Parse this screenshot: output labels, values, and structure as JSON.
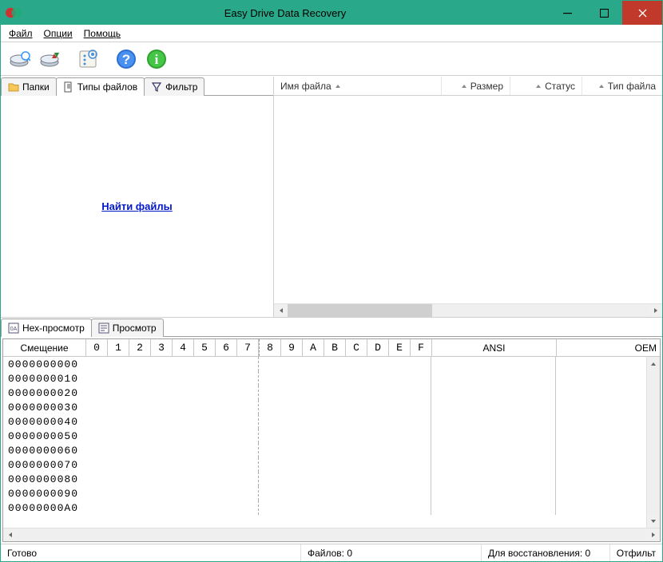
{
  "title": "Easy Drive Data Recovery",
  "menu": {
    "file": "Файл",
    "options": "Опции",
    "help": "Помощь"
  },
  "left_tabs": {
    "folders": "Папки",
    "file_types": "Типы файлов",
    "filter": "Фильтр"
  },
  "find_link": "Найти файлы",
  "list_columns": {
    "name": "Имя файла",
    "size": "Размер",
    "status": "Статус",
    "type": "Тип файла"
  },
  "lower_tabs": {
    "hex": "Нех-просмотр",
    "preview": "Просмотр"
  },
  "hex_header": {
    "offset": "Смещение",
    "bytes": [
      "0",
      "1",
      "2",
      "3",
      "4",
      "5",
      "6",
      "7",
      "8",
      "9",
      "A",
      "B",
      "C",
      "D",
      "E",
      "F"
    ],
    "ansi": "ANSI",
    "oem": "OEM"
  },
  "offsets": [
    "0000000000",
    "0000000010",
    "0000000020",
    "0000000030",
    "0000000040",
    "0000000050",
    "0000000060",
    "0000000070",
    "0000000080",
    "0000000090",
    "00000000A0"
  ],
  "status": {
    "ready": "Готово",
    "files": "Файлов: 0",
    "restore": "Для восстановления: 0",
    "filter": "Отфильт"
  }
}
